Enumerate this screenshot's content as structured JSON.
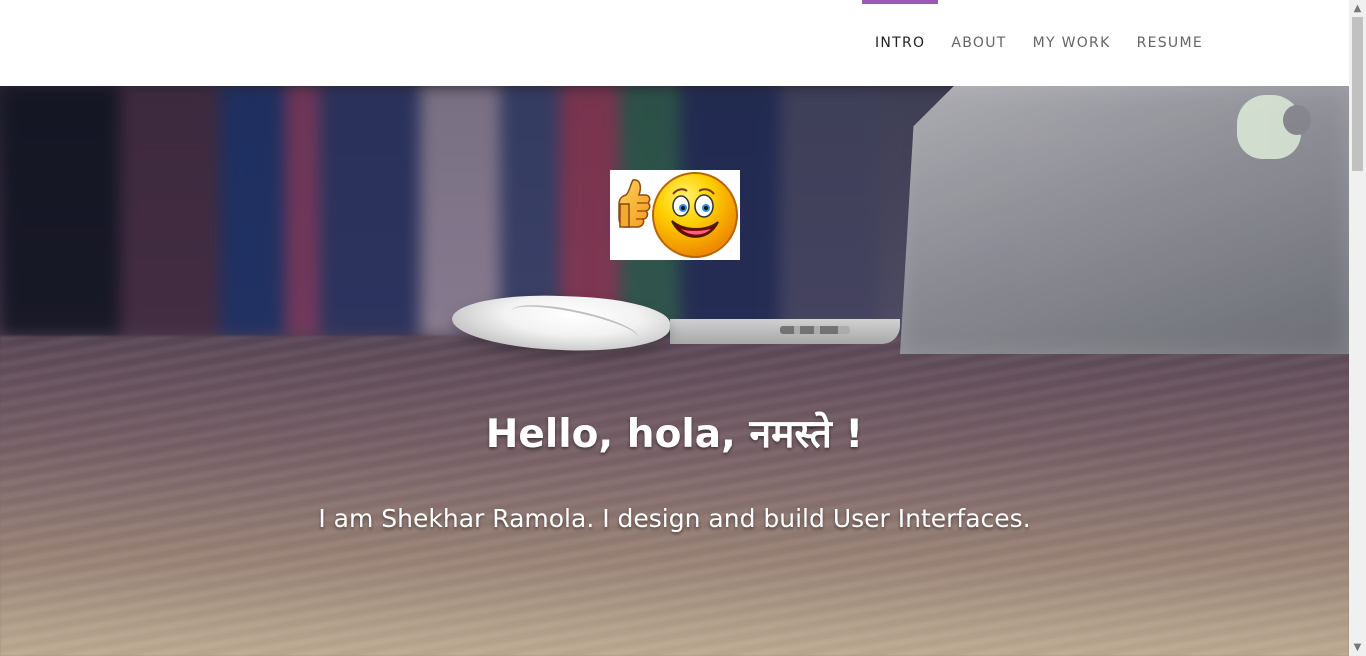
{
  "header": {
    "nav": [
      {
        "label": "INTRO",
        "active": true
      },
      {
        "label": "ABOUT",
        "active": false
      },
      {
        "label": "MY WORK",
        "active": false
      },
      {
        "label": "RESUME",
        "active": false
      }
    ],
    "accent_color": "#9b59b6"
  },
  "hero": {
    "title": "Hello, hola, नमस्ते !",
    "subtitle": "I am Shekhar Ramola. I design and build User Interfaces.",
    "image_icons": [
      "thumbs-up-icon",
      "smiley-face-icon"
    ]
  },
  "window": {
    "scrollbar_up": "▲",
    "scrollbar_down": "▼"
  }
}
